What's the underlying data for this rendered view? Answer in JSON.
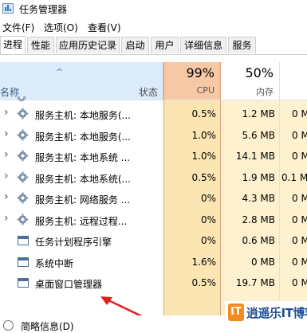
{
  "window": {
    "title": "任务管理器"
  },
  "menu": [
    {
      "label": "文件(F)"
    },
    {
      "label": "选项(O)"
    },
    {
      "label": "查看(V)"
    }
  ],
  "tabs": [
    {
      "label": "进程",
      "active": true
    },
    {
      "label": "性能"
    },
    {
      "label": "应用历史记录"
    },
    {
      "label": "启动"
    },
    {
      "label": "用户"
    },
    {
      "label": "详细信息"
    },
    {
      "label": "服务"
    }
  ],
  "columns": {
    "name": "名称",
    "status": "状态",
    "cpu": {
      "percent": "99%",
      "label": "CPU"
    },
    "memory": {
      "percent": "50%",
      "label": "内存"
    }
  },
  "rows": [
    {
      "name": "服务主机: 本地服务(...",
      "cpu": "0.5%",
      "memory": "1.2 MB",
      "disk": "0 M",
      "icon": "gear-icon",
      "expandable": true
    },
    {
      "name": "服务主机: 本地服务(...",
      "cpu": "1.0%",
      "memory": "5.6 MB",
      "disk": "0 M",
      "icon": "gear-icon",
      "expandable": true
    },
    {
      "name": "服务主机: 本地系统 ...",
      "cpu": "1.0%",
      "memory": "14.1 MB",
      "disk": "0 M",
      "icon": "gear-icon",
      "expandable": true
    },
    {
      "name": "服务主机: 本地系统(...",
      "cpu": "0.5%",
      "memory": "1.9 MB",
      "disk": "0.1 M",
      "icon": "gear-icon",
      "expandable": true
    },
    {
      "name": "服务主机: 网络服务 ...",
      "cpu": "0%",
      "memory": "4.3 MB",
      "disk": "0 M",
      "icon": "gear-icon",
      "expandable": true
    },
    {
      "name": "服务主机: 远程过程...",
      "cpu": "0%",
      "memory": "2.8 MB",
      "disk": "0 M",
      "icon": "gear-icon",
      "expandable": true
    },
    {
      "name": "任务计划程序引擎",
      "cpu": "0%",
      "memory": "0.6 MB",
      "disk": "0 M",
      "icon": "window-icon",
      "expandable": false
    },
    {
      "name": "系统中断",
      "cpu": "1.6%",
      "memory": "0 MB",
      "disk": "0 M",
      "icon": "window-icon",
      "expandable": false
    },
    {
      "name": "桌面窗口管理器",
      "cpu": "0.5%",
      "memory": "19.7 MB",
      "disk": "0 M",
      "icon": "window-icon",
      "expandable": false
    }
  ],
  "footer": {
    "label": "简略信息(D)"
  },
  "watermark": {
    "logo": "IT",
    "text": "逍遥乐IT博客"
  },
  "colors": {
    "cpu_header": "#f7c8a6",
    "cpu_column": "#fbe6b3",
    "name_header": "#dcecfa",
    "annotation_arrow": "#e02020"
  }
}
